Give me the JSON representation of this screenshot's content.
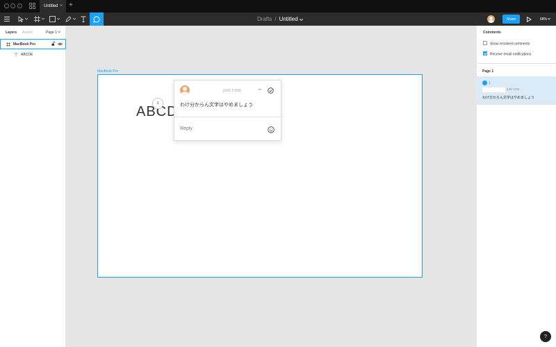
{
  "tabbar": {
    "tab_label": "Untitled",
    "close_glyph": "×",
    "new_tab_glyph": "+"
  },
  "toolbar": {
    "breadcrumb_parent": "Drafts",
    "breadcrumb_sep": "/",
    "file_name": "Untitled",
    "share_label": "Share",
    "zoom_label": "68%"
  },
  "left_panel": {
    "tabs": [
      "Layers",
      "Assets"
    ],
    "page_selector": "Page 1",
    "layers": [
      {
        "name": "MacBook Pro",
        "icon": "frame-icon"
      },
      {
        "name": "ABCDE",
        "icon": "text-icon"
      }
    ]
  },
  "canvas": {
    "frame_label": "MacBook Pro",
    "text": "ABCDE",
    "pin_number": "1",
    "comment": {
      "time": "just now",
      "more_glyph": "···",
      "body": "わけ分からん文字はやめましょう",
      "reply_placeholder": "Reply"
    }
  },
  "right_panel": {
    "title": "Comments",
    "options": [
      {
        "label": "Show resolved comments",
        "checked": false
      },
      {
        "label": "Receive email notifications",
        "checked": true
      }
    ],
    "page_label": "Page 1",
    "thread": {
      "number": "1",
      "time": "just now",
      "text": "わけ分からん文字はやめましょう"
    }
  },
  "help_label": "?",
  "colors": {
    "accent": "#18a0fb",
    "toolbar_bg": "#2c2c2c",
    "tabbar_bg": "#0f0f0f",
    "canvas_bg": "#e5e5e5",
    "thread_highlight": "#daebf7"
  }
}
